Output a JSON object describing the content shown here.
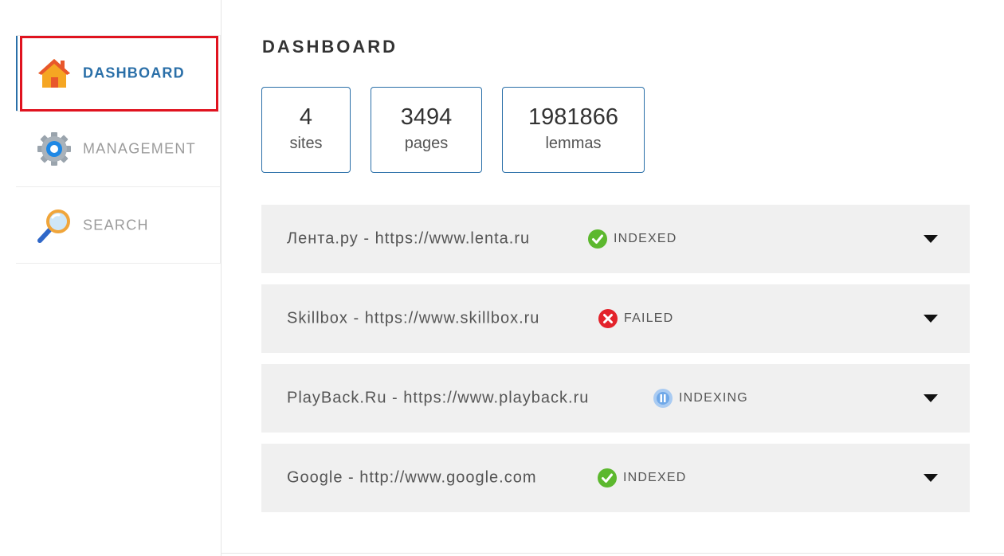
{
  "sidebar": {
    "items": [
      {
        "label": "DASHBOARD",
        "icon": "home-icon",
        "active": true
      },
      {
        "label": "MANAGEMENT",
        "icon": "gear-icon",
        "active": false
      },
      {
        "label": "SEARCH",
        "icon": "magnifier-icon",
        "active": false
      }
    ]
  },
  "main": {
    "title": "DASHBOARD",
    "stats": [
      {
        "value": "4",
        "label": "sites"
      },
      {
        "value": "3494",
        "label": "pages"
      },
      {
        "value": "1981866",
        "label": "lemmas"
      }
    ],
    "sites": [
      {
        "name": "Лента.ру - https://www.lenta.ru",
        "status": "INDEXED",
        "status_icon": "check-icon"
      },
      {
        "name": "Skillbox - https://www.skillbox.ru",
        "status": "FAILED",
        "status_icon": "error-icon"
      },
      {
        "name": "PlayBack.Ru - https://www.playback.ru",
        "status": "INDEXING",
        "status_icon": "pause-icon"
      },
      {
        "name": "Google - http://www.google.com",
        "status": "INDEXED",
        "status_icon": "check-icon"
      }
    ]
  },
  "colors": {
    "accent": "#2a6fa8",
    "highlight": "#e0131f",
    "success": "#5cb82e",
    "failed": "#e3232b",
    "indexing": "#6fa8e8",
    "row_bg": "#f0f0f0"
  }
}
